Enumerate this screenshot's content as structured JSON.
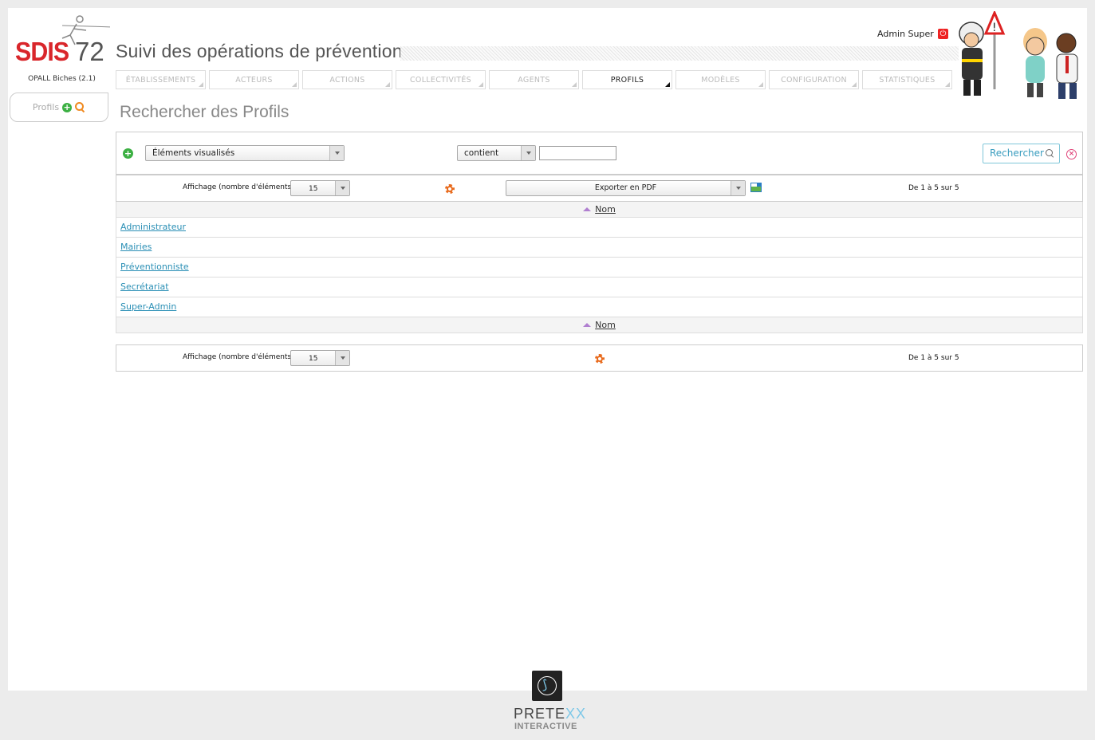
{
  "logo": {
    "text": "SDIS",
    "number": "72"
  },
  "app": {
    "version": "OPALL Biches (2.1)",
    "title": "Suivi des opérations de prévention"
  },
  "sidebar": {
    "tab_label": "Profils"
  },
  "user": {
    "name": "Admin Super"
  },
  "nav": {
    "items": [
      {
        "label": "ÉTABLISSEMENTS"
      },
      {
        "label": "ACTEURS"
      },
      {
        "label": "ACTIONS"
      },
      {
        "label": "COLLECTIVITÉS"
      },
      {
        "label": "AGENTS"
      },
      {
        "label": "PROFILS"
      },
      {
        "label": "MODÈLES"
      },
      {
        "label": "CONFIGURATION"
      },
      {
        "label": "STATISTIQUES"
      }
    ],
    "active": "PROFILS"
  },
  "page": {
    "title": "Rechercher des Profils"
  },
  "filter": {
    "field": "Éléments visualisés",
    "operator": "contient",
    "value": "",
    "search_label": "Rechercher"
  },
  "toolbar": {
    "page_size_label": "Affichage (nombre d'éléments)",
    "page_size": "15",
    "export_label": "Exporter en PDF",
    "range": "De 1 à 5 sur 5"
  },
  "table": {
    "column": "Nom",
    "rows": [
      "Administrateur",
      "Mairies",
      "Préventionniste",
      "Secrétariat",
      "Super-Admin"
    ]
  },
  "footer": {
    "brand": "PRETE",
    "brand_xx": "XX",
    "sub": "INTERACTIVE"
  },
  "colors": {
    "accent": "#2a8fb5",
    "logo_red": "#d9262b",
    "gear": "#e86a1c"
  }
}
